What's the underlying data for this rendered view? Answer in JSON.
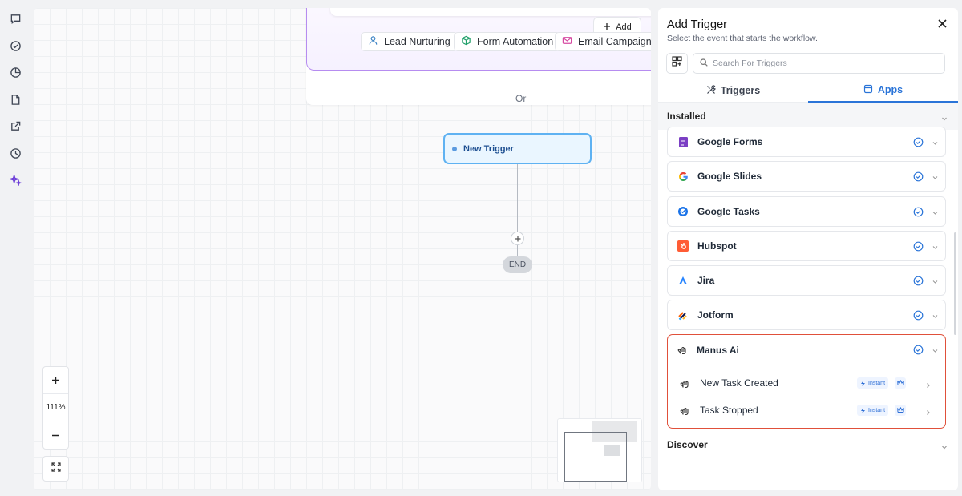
{
  "rail": {
    "items": [
      {
        "icon": "chat-icon"
      },
      {
        "icon": "check-circle-icon"
      },
      {
        "icon": "pie-chart-icon"
      },
      {
        "icon": "document-icon"
      },
      {
        "icon": "external-link-icon"
      },
      {
        "icon": "history-icon"
      },
      {
        "icon": "sparkles-icon"
      }
    ]
  },
  "canvas": {
    "add_label": "Add",
    "chips": [
      {
        "label": "Lead Nurturing",
        "icon": "user-icon",
        "color": "#3b82c4"
      },
      {
        "label": "Form Automation",
        "icon": "cube-icon",
        "color": "#22a06b"
      },
      {
        "label": "Email Campaigns",
        "icon": "mail-icon",
        "color": "#d64aa2"
      }
    ],
    "or_label": "Or",
    "trigger_node": "New Trigger",
    "end_label": "END",
    "zoom_level": "111%"
  },
  "panel": {
    "title": "Add Trigger",
    "subtitle": "Select the event that starts the workflow.",
    "search_placeholder": "Search For Triggers",
    "tabs": [
      {
        "label": "Triggers",
        "active": false
      },
      {
        "label": "Apps",
        "active": true
      }
    ],
    "installed_label": "Installed",
    "discover_label": "Discover",
    "apps": [
      {
        "name": "Google Forms",
        "logo_color": "#7b3fc4"
      },
      {
        "name": "Google Slides",
        "logo_color": "#f4b400"
      },
      {
        "name": "Google Tasks",
        "logo_color": "#1a73e8"
      },
      {
        "name": "Hubspot",
        "logo_color": "#ff5c35"
      },
      {
        "name": "Jira",
        "logo_color": "#2684ff"
      },
      {
        "name": "Jotform",
        "logo_color": "#ff6100"
      }
    ],
    "expanded_app": {
      "name": "Manus Ai",
      "triggers": [
        {
          "label": "New Task Created",
          "badge": "Instant"
        },
        {
          "label": "Task Stopped",
          "badge": "Instant"
        }
      ]
    },
    "accent": "#2a74d8"
  }
}
